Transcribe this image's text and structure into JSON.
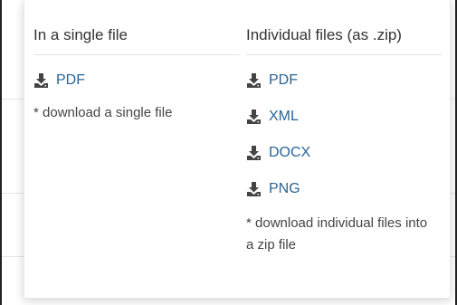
{
  "single": {
    "title": "In a single file",
    "items": [
      {
        "label": "PDF",
        "icon": "download-icon"
      }
    ],
    "note": "* download a single file"
  },
  "individual": {
    "title": "Individual files (as .zip)",
    "items": [
      {
        "label": "PDF",
        "icon": "download-icon"
      },
      {
        "label": "XML",
        "icon": "download-icon"
      },
      {
        "label": "DOCX",
        "icon": "download-icon"
      },
      {
        "label": "PNG",
        "icon": "download-icon"
      }
    ],
    "note": "* download individual files into a zip file"
  },
  "colors": {
    "link": "#2a6496",
    "text": "#333333",
    "icon": "#444444"
  }
}
